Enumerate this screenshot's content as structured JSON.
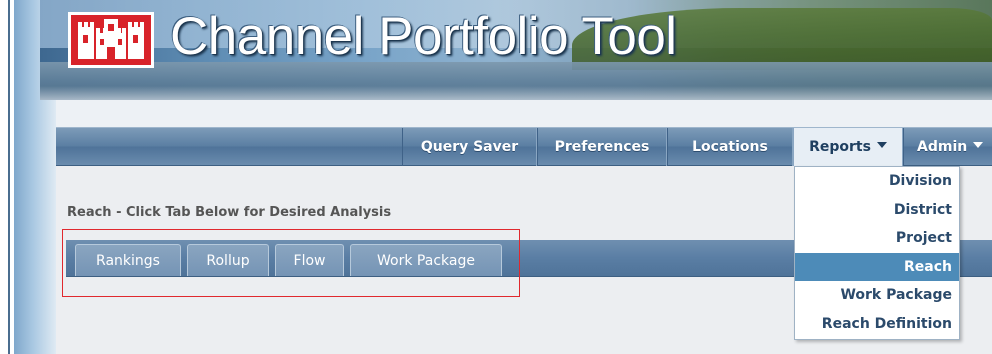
{
  "app": {
    "title": "Channel Portfolio Tool"
  },
  "nav": {
    "items": [
      {
        "label": "Query Saver"
      },
      {
        "label": "Preferences"
      },
      {
        "label": "Locations"
      },
      {
        "label": "Reports"
      },
      {
        "label": "Admin"
      }
    ],
    "active": "Reports"
  },
  "reports_menu": {
    "items": [
      "Division",
      "District",
      "Project",
      "Reach",
      "Work Package",
      "Reach Definition"
    ],
    "selected": "Reach"
  },
  "section": {
    "title": "Reach - Click Tab Below for Desired Analysis"
  },
  "tabs": [
    {
      "label": "Rankings"
    },
    {
      "label": "Rollup"
    },
    {
      "label": "Flow"
    },
    {
      "label": "Work Package"
    }
  ],
  "colors": {
    "logo_red": "#d8232a",
    "nav_blue": "#5b7fa3",
    "menu_highlight": "#4d8bb8",
    "annotation_red": "#e0282e"
  },
  "icons": {
    "logo": "castle-icon",
    "dropdown": "caret-down-icon"
  }
}
